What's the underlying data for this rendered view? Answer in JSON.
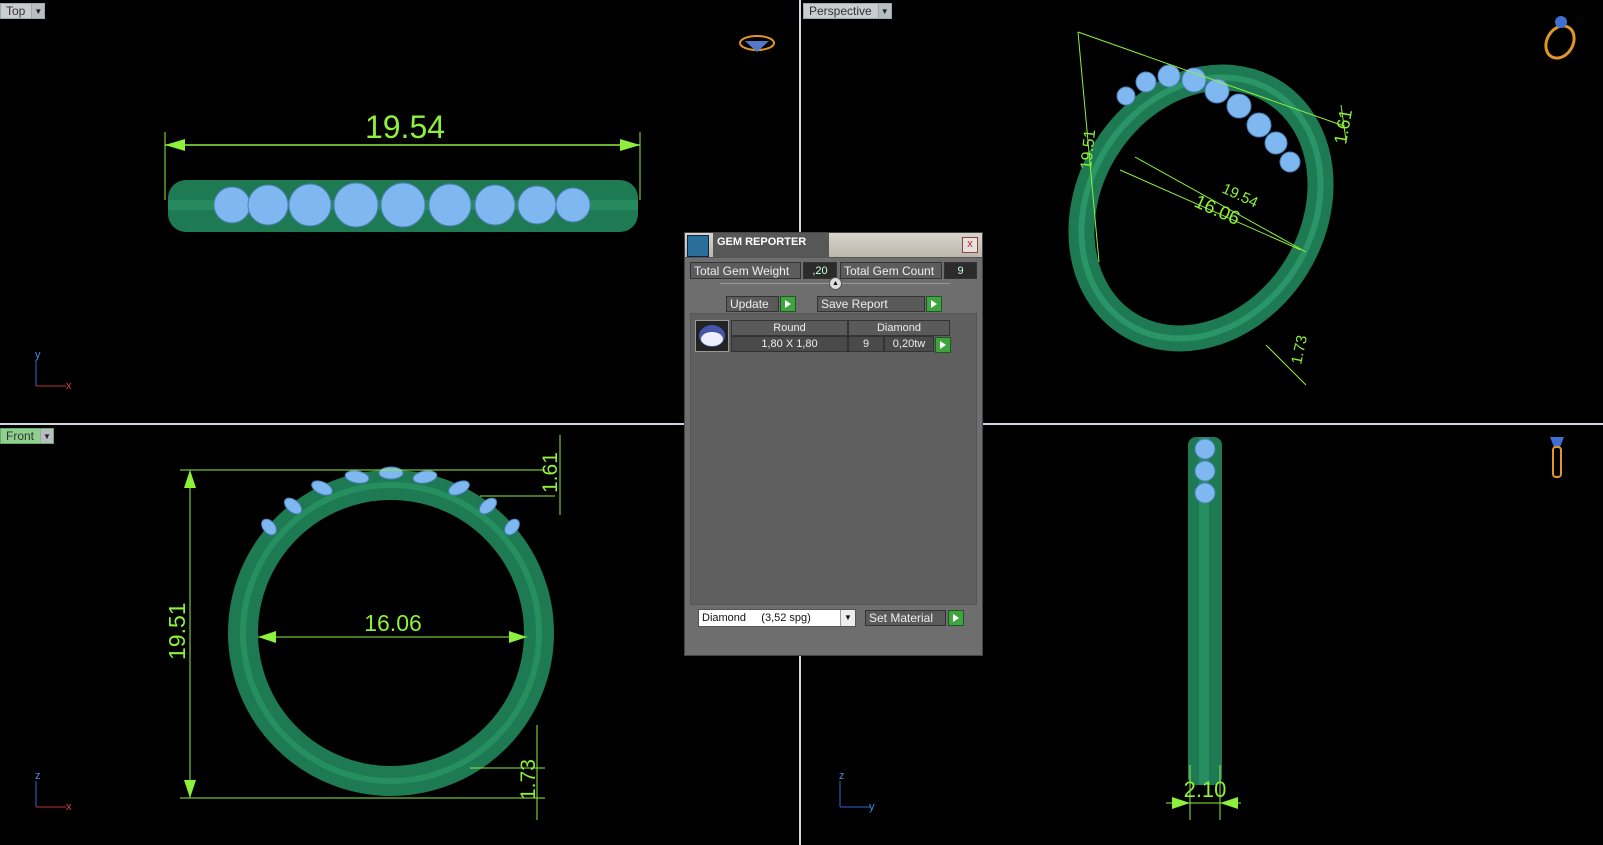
{
  "viewports": {
    "top": {
      "label": "Top",
      "dim_width": "19.54",
      "axis_v": "y",
      "axis_h": "x"
    },
    "perspective": {
      "label": "Perspective",
      "dim_height": "19.51",
      "dim_outer": "19.54",
      "dim_inner": "16.06",
      "dim_top": "1.61",
      "dim_bottom": "1.73"
    },
    "front": {
      "label": "Front",
      "dim_height": "19.51",
      "dim_inner": "16.06",
      "dim_top": "1.61",
      "dim_bottom": "1.73",
      "axis_v": "z",
      "axis_h": "x"
    },
    "right": {
      "dim_width": "2.10",
      "axis_v": "z",
      "axis_h": "y"
    }
  },
  "gem_reporter": {
    "title": "GEM REPORTER",
    "close_label": "x",
    "total_weight_label": "Total Gem Weight",
    "total_weight_value": ",20",
    "total_count_label": "Total Gem Count",
    "total_count_value": "9",
    "update_label": "Update",
    "save_report_label": "Save Report",
    "gems": [
      {
        "shape": "Round",
        "material": "Diamond",
        "size": "1,80 X 1,80",
        "count": "9",
        "weight": "0,20tw"
      }
    ],
    "material_select": "Diamond     (3,52 spg)",
    "set_material_label": "Set Material"
  },
  "colors": {
    "ring": "#1e7a52",
    "gem": "#7fb8f0",
    "dimension": "#8ef03a",
    "background": "#000000"
  }
}
